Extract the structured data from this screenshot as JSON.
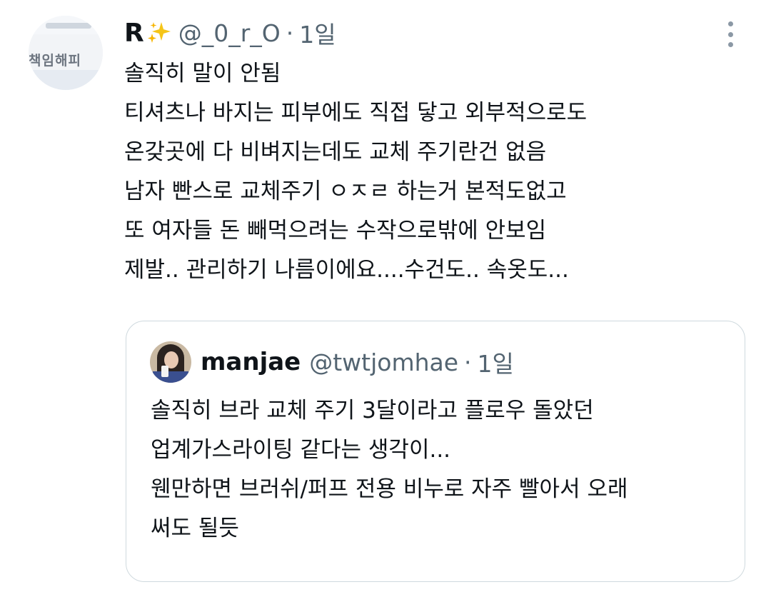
{
  "tweet": {
    "display_name": "R",
    "handle": "@_0_r_O",
    "separator": "·",
    "time": "1일",
    "avatar_text": "책임해피",
    "lines": [
      "솔직히 말이 안됨",
      "티셔츠나 바지는 피부에도 직접 닿고 외부적으로도",
      "온갖곳에 다 비벼지는데도 교체 주기란건 없음",
      "남자 빤스로 교체주기 ㅇㅈㄹ 하는거 본적도없고",
      "또 여자들 돈 빼먹으려는 수작으로밖에 안보임",
      "제발.. 관리하기 나름이에요....수건도.. 속옷도..."
    ]
  },
  "quoted": {
    "display_name": "manjae",
    "handle": "@twtjomhae",
    "separator": "·",
    "time": "1일",
    "lines": [
      "솔직히 브라 교체 주기 3달이라고 플로우 돌았던",
      "업계가스라이팅 같다는 생각이...",
      "웬만하면 브러쉬/퍼프 전용 비누로 자주 빨아서 오래",
      "써도 될듯"
    ]
  },
  "icons": {
    "sparkle": "sparkles-emoji",
    "more": "more-vertical-icon"
  },
  "colors": {
    "text": "#0f1419",
    "secondary": "#536471",
    "border": "#cfd9de",
    "sparkle": "#f5c518"
  }
}
